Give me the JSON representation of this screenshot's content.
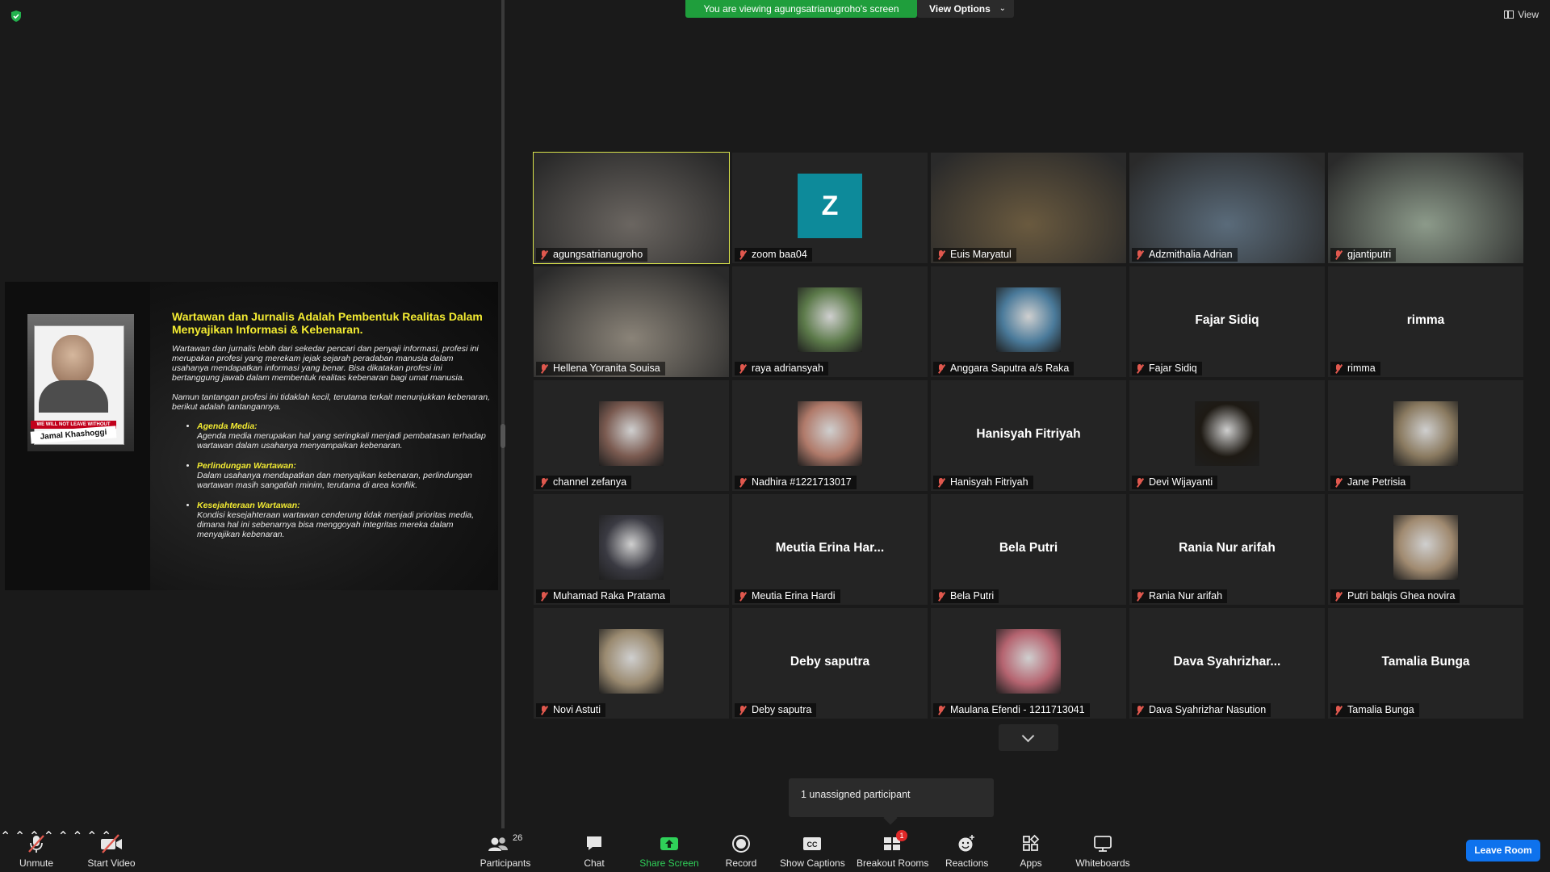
{
  "top": {
    "banner": "You are viewing agungsatrianugroho's screen",
    "view_options": "View Options",
    "view": "View"
  },
  "slide": {
    "title": "Wartawan dan Jurnalis Adalah Pembentuk Realitas Dalam Menyajikan Informasi & Kebenaran.",
    "para1": "Wartawan dan jurnalis lebih dari sekedar pencari dan penyaji informasi, profesi ini merupakan profesi yang merekam jejak sejarah peradaban manusia dalam usahanya mendapatkan informasi yang benar. Bisa dikatakan profesi ini bertanggung jawab dalam membentuk realitas kebenaran bagi umat manusia.",
    "para2": "Namun tantangan profesi ini tidaklah kecil, terutama terkait menunjukkan kebenaran, berikut adalah tantangannya.",
    "bullets": [
      {
        "head": "Agenda Media:",
        "text": "Agenda media merupakan hal yang seringkali menjadi pembatasan terhadap wartawan dalam usahanya menyampaikan kebenaran."
      },
      {
        "head": "Perlindungan Wartawan:",
        "text": "Dalam usahanya mendapatkan dan menyajikan kebenaran, perlindungan wartawan masih sangatlah minim, terutama di area konflik."
      },
      {
        "head": "Kesejahteraan Wartawan:",
        "text": "Kondisi kesejahteraan wartawan cenderung tidak menjadi prioritas media, dimana hal ini sebenarnya bisa menggoyah integritas mereka dalam menyajikan kebenaran."
      }
    ],
    "photo_band": "WE WILL NOT LEAVE WITHOUT",
    "photo_name": "Jamal Khashoggi"
  },
  "participants": [
    {
      "name": "agungsatrianugroho",
      "kind": "video",
      "color": "#6b6661",
      "active": true
    },
    {
      "name": "zoom baa04",
      "kind": "letter",
      "letter": "Z"
    },
    {
      "name": "Euis Maryatul",
      "kind": "video",
      "color": "#6a5a3f"
    },
    {
      "name": "Adzmithalia Adrian",
      "kind": "video",
      "color": "#5a6b7a"
    },
    {
      "name": "gjantiputri",
      "kind": "video",
      "color": "#8c9a8a"
    },
    {
      "name": "Hellena Yoranita Souisa",
      "kind": "video",
      "color": "#8a8378"
    },
    {
      "name": "raya adriansyah",
      "kind": "photo",
      "color": "#5c7a4a"
    },
    {
      "name": "Anggara Saputra a/s Raka",
      "kind": "photo",
      "color": "#4a7a9a"
    },
    {
      "name": "Fajar Sidiq",
      "kind": "text",
      "display": "Fajar Sidiq"
    },
    {
      "name": "rimma",
      "kind": "text",
      "display": "rimma"
    },
    {
      "name": "channel zefanya",
      "kind": "photo",
      "color": "#7a5a50"
    },
    {
      "name": "Nadhira #1221713017",
      "kind": "photo",
      "color": "#b07a6a"
    },
    {
      "name": "Hanisyah Fitriyah",
      "kind": "text",
      "display": "Hanisyah Fitriyah"
    },
    {
      "name": "Devi Wijayanti",
      "kind": "photo",
      "color": "#1e1a14"
    },
    {
      "name": "Jane Petrisia",
      "kind": "photo",
      "color": "#8a7a60"
    },
    {
      "name": "Muhamad Raka Pratama",
      "kind": "photo",
      "color": "#3a3a42"
    },
    {
      "name": "Meutia Erina Hardi",
      "kind": "text",
      "display": "Meutia Erina Har..."
    },
    {
      "name": "Bela Putri",
      "kind": "text",
      "display": "Bela Putri"
    },
    {
      "name": "Rania Nur arifah",
      "kind": "text",
      "display": "Rania Nur arifah"
    },
    {
      "name": "Putri balqis Ghea novira",
      "kind": "photo",
      "color": "#a08a70"
    },
    {
      "name": "Novi Astuti",
      "kind": "photo",
      "color": "#9a8a70"
    },
    {
      "name": "Deby saputra",
      "kind": "text",
      "display": "Deby saputra"
    },
    {
      "name": "Maulana Efendi - 1211713041",
      "kind": "photo",
      "color": "#b56470"
    },
    {
      "name": "Dava Syahrizhar Nasution",
      "kind": "text",
      "display": "Dava  Syahrizhar..."
    },
    {
      "name": "Tamalia Bunga",
      "kind": "text",
      "display": "Tamalia Bunga"
    }
  ],
  "unassigned": "1 unassigned participant",
  "toolbar": {
    "unmute": "Unmute",
    "start_video": "Start Video",
    "participants": "Participants",
    "participants_count": "26",
    "chat": "Chat",
    "share_screen": "Share Screen",
    "record": "Record",
    "show_captions": "Show Captions",
    "breakout_rooms": "Breakout Rooms",
    "breakout_badge": "1",
    "reactions": "Reactions",
    "apps": "Apps",
    "whiteboards": "Whiteboards",
    "leave_room": "Leave Room"
  }
}
